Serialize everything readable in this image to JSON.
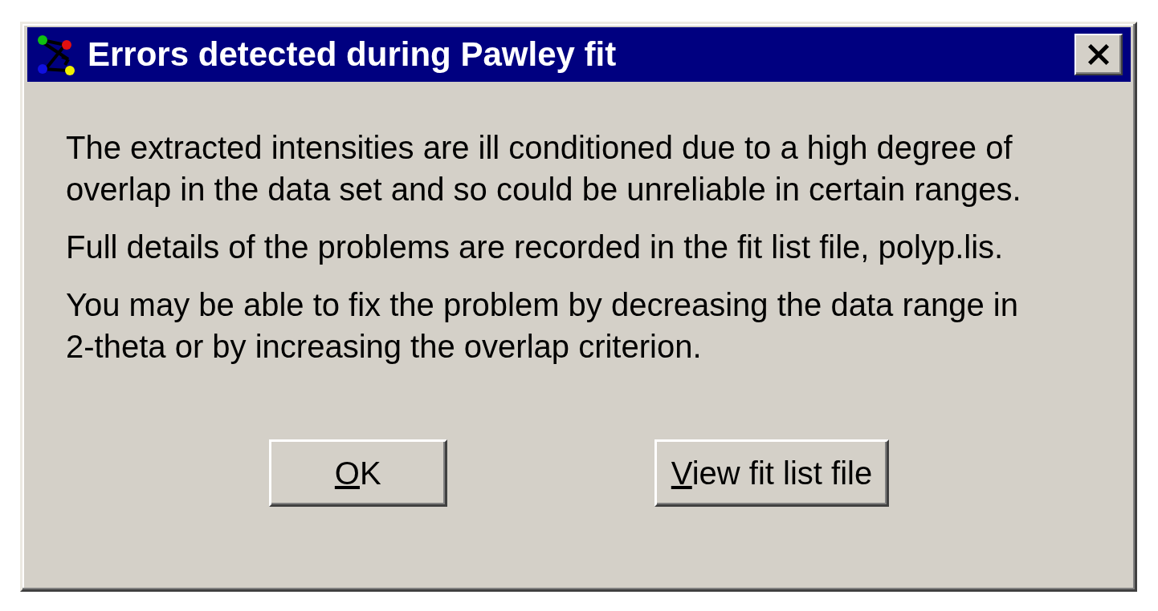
{
  "window": {
    "title": "Errors detected during Pawley fit"
  },
  "message": [
    "The extracted intensities are ill conditioned due to a high degree of overlap in the data set and so could be unreliable in certain ranges.",
    "Full details of the problems are recorded in the fit list file, polyp.lis.",
    "You may be able to fix the problem by decreasing the data range in 2-theta or by increasing the overlap criterion."
  ],
  "buttons": [
    {
      "label": "OK",
      "mnemonic": true
    },
    {
      "label": "View fit list file",
      "mnemonic": true
    }
  ]
}
